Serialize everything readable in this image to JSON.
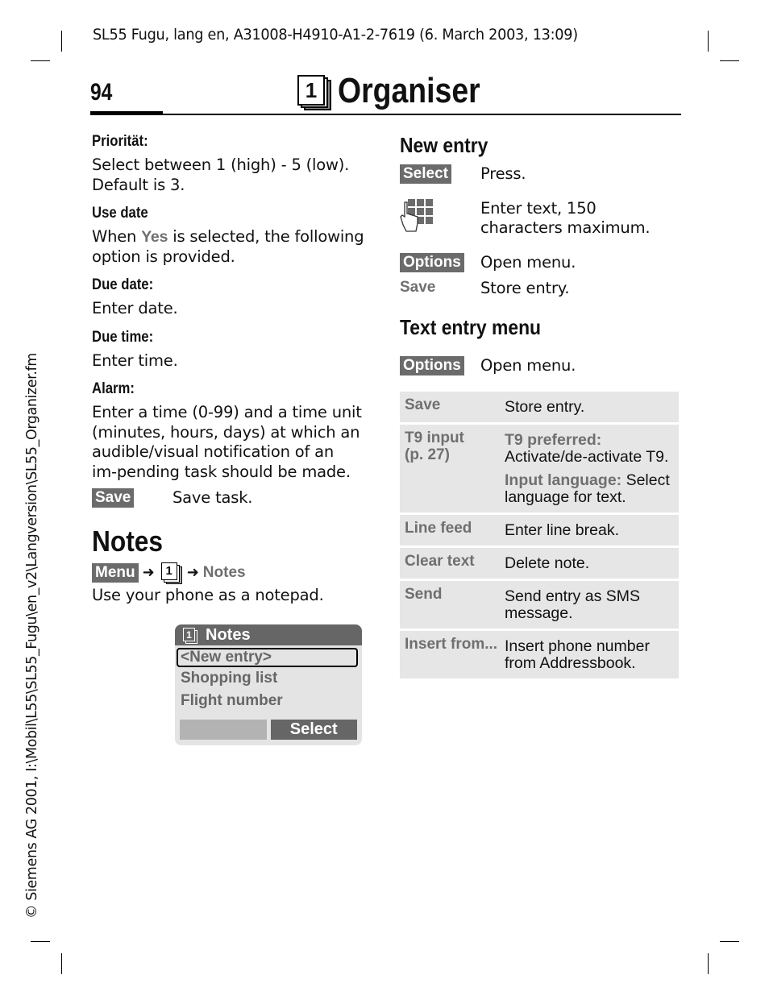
{
  "header": {
    "doc_info": "SL55 Fugu, lang en, A31008-H4910-A1-2-7619 (6. March 2003, 13:09)",
    "page_number": "94",
    "chapter_title": "Organiser",
    "chapter_icon_digit": "1"
  },
  "side_margin_text": "© Siemens AG 2001, I:\\Mobil\\L55\\SL55_Fugu\\en_v2\\Langversion\\SL55_Organizer.fm",
  "left_column": {
    "fields": [
      {
        "label": "Priorität:",
        "text": "Select between 1 (high) - 5 (low). Default is 3."
      },
      {
        "label": "Use date",
        "text_before": "When ",
        "keyword": "Yes",
        "text_after": " is selected, the following option is provided."
      },
      {
        "label": "Due date:",
        "text": "Enter date."
      },
      {
        "label": "Due time:",
        "text": "Enter time."
      },
      {
        "label": "Alarm:",
        "text": "Enter a time (0-99) and a time unit (minutes, hours, days) at which an audible/visual notification of an im-pending task should be made."
      }
    ],
    "save_step": {
      "softkey": "Save",
      "text": "Save task."
    },
    "notes": {
      "heading": "Notes",
      "path": {
        "menu_key": "Menu",
        "arrow1": "➜",
        "icon_digit": "1",
        "arrow2": "➜",
        "target": "Notes"
      },
      "description": "Use your phone as a notepad."
    },
    "phone_screen": {
      "title": "Notes",
      "icon_digit": "1",
      "items": [
        "<New entry>",
        "Shopping list",
        "Flight number"
      ],
      "selected_index": 0,
      "right_softkey": "Select",
      "left_softkey": ""
    }
  },
  "right_column": {
    "new_entry": {
      "heading": "New entry",
      "steps": [
        {
          "key_type": "softkey",
          "key": "Select",
          "text": "Press."
        },
        {
          "key_type": "icon",
          "icon": "keypad-hand-icon",
          "text": "Enter text, 150 characters maximum."
        },
        {
          "key_type": "softkey",
          "key": "Options",
          "text": "Open menu."
        },
        {
          "key_type": "plain",
          "key": "Save",
          "text": "Store entry."
        }
      ]
    },
    "text_entry_menu": {
      "heading": "Text entry menu",
      "step": {
        "key": "Options",
        "text": "Open menu."
      },
      "table": [
        {
          "key": "Save",
          "value": "Store entry."
        },
        {
          "key": "T9 input\n(p. 27)",
          "key_line1": "T9 input",
          "key_line2": "(p. 27)",
          "sub": [
            {
              "keyword": "T9 preferred:",
              "text": " Activate/de-activate T9."
            },
            {
              "keyword": "Input language:",
              "text": " Select language for text."
            }
          ]
        },
        {
          "key": "Line feed",
          "value": "Enter line break."
        },
        {
          "key": "Clear text",
          "value": "Delete note."
        },
        {
          "key": "Send",
          "value": "Send entry as SMS message."
        },
        {
          "key": "Insert from...",
          "value": "Insert phone number from Addressbook."
        }
      ]
    }
  },
  "colors": {
    "softkey_bg": "#6b6b6b",
    "keyword_grey": "#6f6f6f",
    "table_bg": "#e6e6e6",
    "phone_bg": "#e4e4e4"
  }
}
